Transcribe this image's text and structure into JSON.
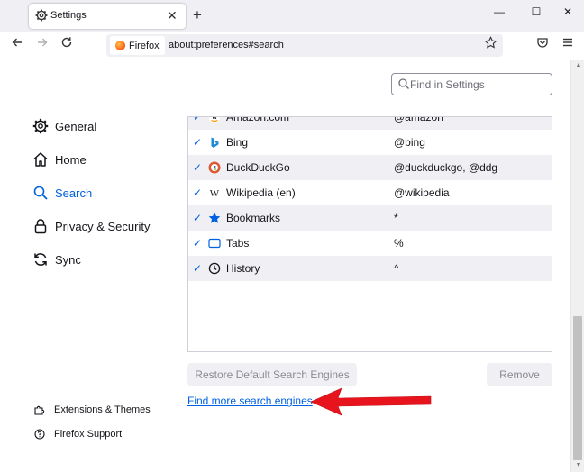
{
  "tabbar": {
    "tab_title": "Settings",
    "new_tab": "+",
    "window_controls": [
      "—",
      "☐",
      "✕"
    ]
  },
  "navbar": {
    "identity_label": "Firefox",
    "url": "about:preferences#search"
  },
  "search_settings": {
    "placeholder": "Find in Settings"
  },
  "sidebar": {
    "items": [
      {
        "label": "General",
        "icon": "gear-icon"
      },
      {
        "label": "Home",
        "icon": "home-icon"
      },
      {
        "label": "Search",
        "icon": "search-icon",
        "active": true
      },
      {
        "label": "Privacy & Security",
        "icon": "lock-icon"
      },
      {
        "label": "Sync",
        "icon": "sync-icon"
      }
    ],
    "footer": [
      {
        "label": "Extensions & Themes",
        "icon": "puzzle-icon"
      },
      {
        "label": "Firefox Support",
        "icon": "help-icon"
      }
    ]
  },
  "engines": {
    "rows": [
      {
        "name": "Amazon.com",
        "keyword": "@amazon",
        "icon": "amazon-icon",
        "checked": true
      },
      {
        "name": "Bing",
        "keyword": "@bing",
        "icon": "bing-icon",
        "checked": true
      },
      {
        "name": "DuckDuckGo",
        "keyword": "@duckduckgo, @ddg",
        "icon": "duckduckgo-icon",
        "checked": true
      },
      {
        "name": "Wikipedia (en)",
        "keyword": "@wikipedia",
        "icon": "wikipedia-icon",
        "checked": true
      },
      {
        "name": "Bookmarks",
        "keyword": "*",
        "icon": "star-icon",
        "checked": true
      },
      {
        "name": "Tabs",
        "keyword": "%",
        "icon": "tab-icon",
        "checked": true
      },
      {
        "name": "History",
        "keyword": "^",
        "icon": "clock-icon",
        "checked": true
      }
    ]
  },
  "buttons": {
    "restore": "Restore Default Search Engines",
    "remove": "Remove"
  },
  "links": {
    "find_more": "Find more search engines"
  },
  "colors": {
    "accent": "#0061e0",
    "annotation_arrow": "#e8141d"
  }
}
